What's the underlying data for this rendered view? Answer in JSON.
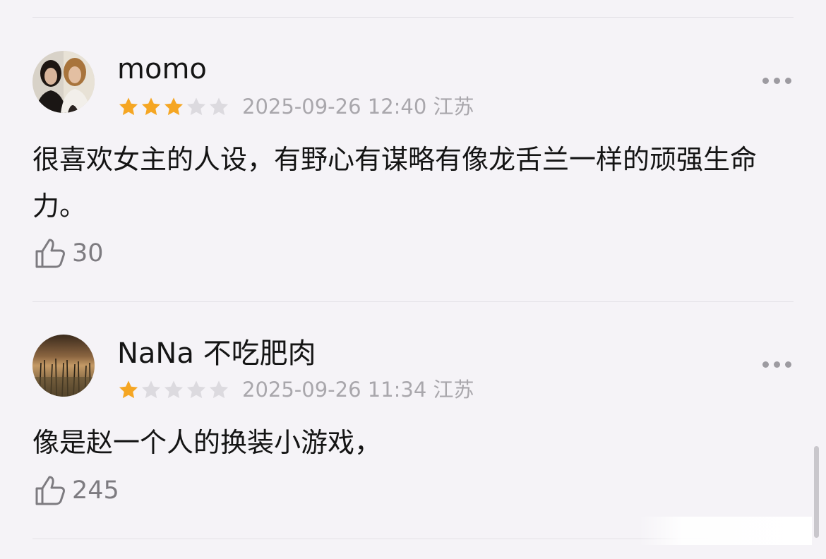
{
  "reviews": [
    {
      "username": "momo",
      "rating": 3,
      "max_rating": 5,
      "date": "2025-09-26 12:40",
      "location": "江苏",
      "text": "很喜欢女主的人设，有野心有谋略有像龙舌兰一样的顽强生命力。",
      "likes": "30"
    },
    {
      "username": "NaNa 不吃肥肉",
      "rating": 1,
      "max_rating": 5,
      "date": "2025-09-26 11:34",
      "location": "江苏",
      "text": "像是赵一个人的换装小游戏，",
      "likes": "245"
    }
  ],
  "colors": {
    "star_filled": "#f5a623",
    "star_empty": "#dcdadf",
    "background": "#f5f3f7",
    "meta_text": "#a9a7ac"
  },
  "icons": {
    "like": "thumbs-up-icon",
    "more": "more-icon",
    "star": "star-icon"
  }
}
